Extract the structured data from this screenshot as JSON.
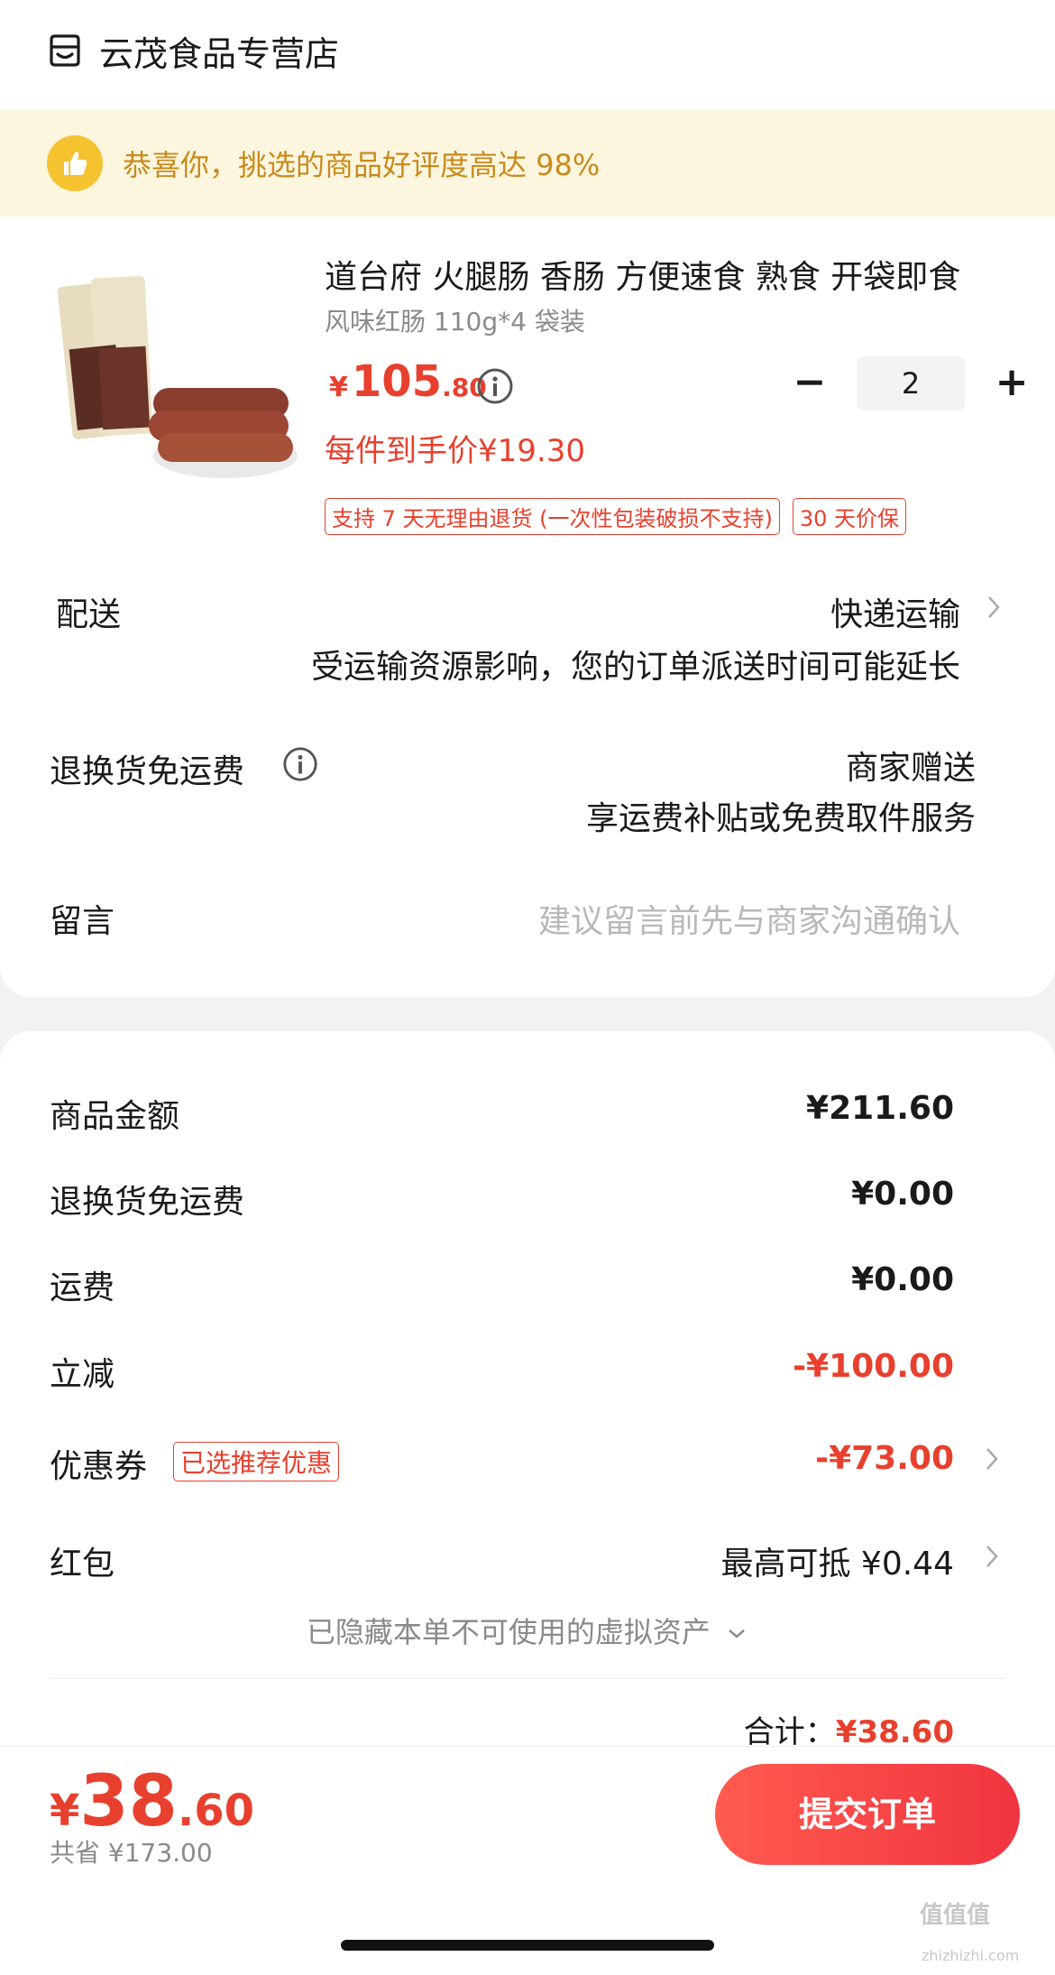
{
  "store": {
    "name": "云茂食品专营店",
    "icon": "store-icon"
  },
  "banner": {
    "text": "恭喜你，挑选的商品好评度高达 98%",
    "icon": "thumbs-up-icon"
  },
  "product": {
    "title": "道台府 火腿肠 香肠 方便速食 熟食 开袋即食",
    "spec": "风味红肠 110g*4 袋装",
    "price_symbol": "¥",
    "price_int": "105",
    "price_dec": ".80",
    "per_item_price": "每件到手价¥19.30",
    "quantity": "2",
    "minus": "−",
    "plus": "+",
    "tags": [
      "支持 7 天无理由退货 (一次性包装破损不支持)",
      "30 天价保"
    ]
  },
  "delivery": {
    "label": "配送",
    "method": "快递运输",
    "note": "受运输资源影响，您的订单派送时间可能延长"
  },
  "return_shipping": {
    "label": "退换货免运费",
    "value": "商家赠送",
    "note": "享运费补贴或免费取件服务"
  },
  "message": {
    "label": "留言",
    "placeholder": "建议留言前先与商家沟通确认"
  },
  "summary": {
    "goods_amount_label": "商品金额",
    "goods_amount": "¥211.60",
    "return_free_label": "退换货免运费",
    "return_free": "¥0.00",
    "shipping_label": "运费",
    "shipping": "¥0.00",
    "discount_label": "立减",
    "discount": "-¥100.00",
    "coupon_label": "优惠券",
    "coupon_tag": "已选推荐优惠",
    "coupon": "-¥73.00",
    "redpacket_label": "红包",
    "redpacket": "最高可抵 ¥0.44",
    "hidden_assets": "已隐藏本单不可使用的虚拟资产",
    "total_label": "合计：",
    "total": "¥38.60"
  },
  "footer": {
    "price_symbol": "¥",
    "price_int": "38",
    "price_dec": ".60",
    "saved": "共省 ¥173.00",
    "submit": "提交订单"
  },
  "watermark": {
    "main": "值值值",
    "sub": "zhizhizhi.com"
  },
  "colors": {
    "accent": "#e8402e",
    "banner_bg": "#fdf6df",
    "banner_text": "#c98a1b"
  }
}
